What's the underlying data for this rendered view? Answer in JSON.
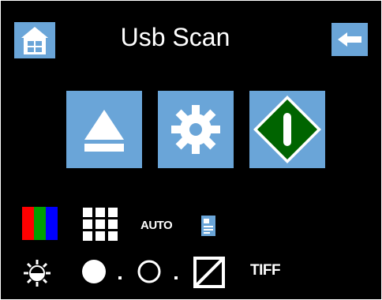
{
  "header": {
    "title": "Usb Scan",
    "home_icon": "home-icon",
    "back_icon": "back-arrow-icon"
  },
  "actions": {
    "eject_icon": "eject-icon",
    "settings_icon": "gear-icon",
    "start_icon": "start-scan-icon"
  },
  "options": {
    "color_mode_icon": "rgb-color-icon",
    "resolution_icon": "grid-icon",
    "auto_label": "AUTO",
    "document_icon": "document-icon",
    "brightness_icon": "brightness-icon",
    "density_dark_icon": "filled-circle-icon",
    "density_light_icon": "outline-circle-icon",
    "contrast_icon": "contrast-icon",
    "format_label": "TIFF"
  },
  "colors": {
    "button_blue": "#6aa5d8",
    "start_green": "#006400",
    "background": "#000000",
    "rgb": [
      "#ff0000",
      "#00a000",
      "#0000ff"
    ]
  }
}
